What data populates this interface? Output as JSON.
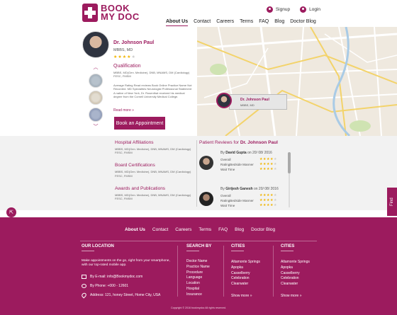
{
  "header": {
    "logo_line1": "BOOK",
    "logo_line2": "MY DOC",
    "signup": "Signup",
    "login": "Login",
    "nav": [
      "About Us",
      "Contact",
      "Careers",
      "Terms",
      "FAQ",
      "Blog",
      "Doctor Blog"
    ]
  },
  "doctor": {
    "name": "Dr. Johnson Paul",
    "degree": "MBBS, MD",
    "rating": 4,
    "qualification_title": "Qualification",
    "qualification_text": "MBBS, MD(Gen. Medicine), DNB, MNAMS, DM (Cardiology) FESC, FMSM",
    "description": "Average Rating Read reviews Book Online Practice Name Not Recorded. MD Specialties Neurologist Professional Statement A native of New York, Dr. Rosenthal received his medical degree from the Cornell University Medical College.",
    "read_more": "Read more",
    "book_button": "Book an Appointment"
  },
  "map_pin": {
    "name": "Dr. Johnson Paul",
    "degree": "MBBS, MD"
  },
  "affiliations": [
    {
      "title": "Hospital Affiliations",
      "text": "MBBS, MD(Gen. Medicine), DNB, MNAMS, DM (Cardiology) FESC, FMSM"
    },
    {
      "title": "Board Certifications",
      "text": "MBBS, MD(Gen. Medicine), DNB, MNAMS, DM (Cardiology) FESC, FMSM"
    },
    {
      "title": "Awards and Publications",
      "text": "MBBS, MD(Gen. Medicine), DNB, MNAMS, DM (Cardiology) FESC, FMSM"
    }
  ],
  "reviews": {
    "title_prefix": "Patient Reviews for",
    "doctor": "Dr. Johnson Paul",
    "items": [
      {
        "by_prefix": "By",
        "author": "David Gupta",
        "date": "on 20/ 08/ 2016",
        "rows": [
          "Overall",
          "RatingBedside Manner",
          "Wait Time"
        ],
        "ratings": [
          4,
          4,
          4
        ]
      },
      {
        "by_prefix": "By",
        "author": "Girijesh Ganesh",
        "date": "on 20/ 08/ 2016",
        "rows": [
          "Overall",
          "RatingBedside Manner",
          "Wait Time"
        ],
        "ratings": [
          4,
          4,
          4
        ]
      }
    ]
  },
  "find_tab": "Find",
  "footer": {
    "nav": [
      "About Us",
      "Contact",
      "Careers",
      "Terms",
      "FAQ",
      "Blog",
      "Doctor Blog"
    ],
    "location_title": "OUR LOCATION",
    "location_text": "Make appointments on the go, right from your smartphone, with our top-rated mobile app.",
    "email": "By E-mail: info@Bookmydoc.com",
    "phone": "By Phone: +000 - 12601",
    "address": "Address: 121, honey Street, Home City, USA",
    "search_title": "SEARCH BY",
    "search_items": [
      "Doctor Name",
      "Practice Name",
      "Procedure",
      "Language",
      "Location",
      "Hospital",
      "Insurance"
    ],
    "cities_title_1": "CITIES",
    "cities_1": [
      "Altamonte Springs",
      "Apopka",
      "Casselberry",
      "Celebration",
      "Clearwater"
    ],
    "cities_title_2": "CITIES",
    "cities_2": [
      "Altamonte Springs",
      "Apopka",
      "Casselberry",
      "Celebration",
      "Clearwater"
    ],
    "show_more": "Show more",
    "copyright": "Copyright © 2016 bookmydoc All rights reserved."
  },
  "colors": {
    "brand": "#9c1b5e",
    "star": "#f0b400"
  }
}
